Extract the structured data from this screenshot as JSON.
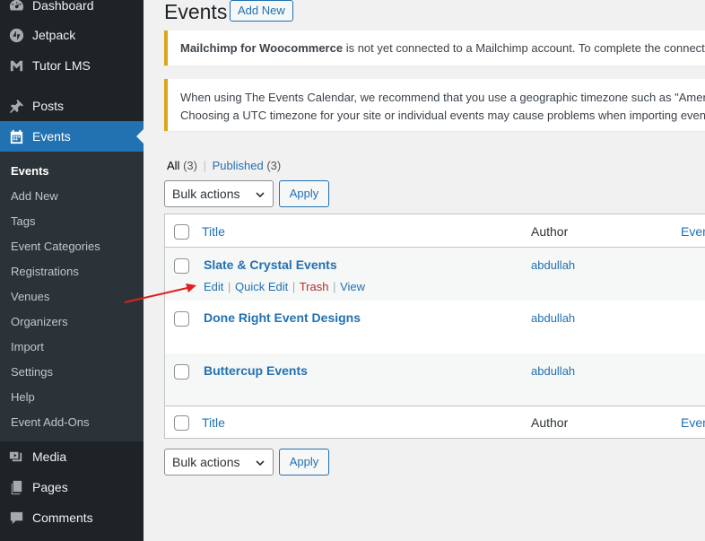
{
  "sidebar": {
    "top_items": [
      {
        "label": "Dashboard",
        "icon": "dashboard-icon"
      },
      {
        "label": "Jetpack",
        "icon": "jetpack-icon"
      },
      {
        "label": "Tutor LMS",
        "icon": "graduation-cap-icon"
      },
      {
        "label": "Posts",
        "icon": "pin-icon"
      },
      {
        "label": "Events",
        "icon": "calendar-icon"
      }
    ],
    "submenu": [
      "Events",
      "Add New",
      "Tags",
      "Event Categories",
      "Registrations",
      "Venues",
      "Organizers",
      "Import",
      "Settings",
      "Help",
      "Event Add-Ons"
    ],
    "bottom_items": [
      {
        "label": "Media",
        "icon": "media-icon"
      },
      {
        "label": "Pages",
        "icon": "pages-icon"
      },
      {
        "label": "Comments",
        "icon": "comment-icon"
      }
    ]
  },
  "header": {
    "title": "Events",
    "add_new": "Add New"
  },
  "notices": {
    "mailchimp_bold": "Mailchimp for Woocommerce",
    "mailchimp_text": " is not yet connected to a Mailchimp account. To complete the connectio",
    "timezone_line1": "When using The Events Calendar, we recommend that you use a geographic timezone such as \"Americ",
    "timezone_line2": "Choosing a UTC timezone for your site or individual events may cause problems when importing event"
  },
  "filters": {
    "all": "All",
    "all_count": "(3)",
    "sep": "|",
    "published": "Published",
    "published_count": "(3)"
  },
  "bulk": {
    "label": "Bulk actions",
    "apply": "Apply"
  },
  "table": {
    "columns": {
      "title": "Title",
      "author": "Author",
      "event": "Even"
    },
    "rows": [
      {
        "title": "Slate & Crystal Events",
        "author": "abdullah"
      },
      {
        "title": "Done Right Event Designs",
        "author": "abdullah"
      },
      {
        "title": "Buttercup Events",
        "author": "abdullah"
      }
    ],
    "row_actions": {
      "edit": "Edit",
      "quick_edit": "Quick Edit",
      "trash": "Trash",
      "view": "View",
      "sep": "|"
    }
  },
  "colors": {
    "sidebar_bg": "#1d2327",
    "submenu_bg": "#2c3338",
    "accent": "#2271b1",
    "notice_warning": "#dba617",
    "trash": "#b32d2e",
    "annotation_arrow": "#e02020"
  }
}
